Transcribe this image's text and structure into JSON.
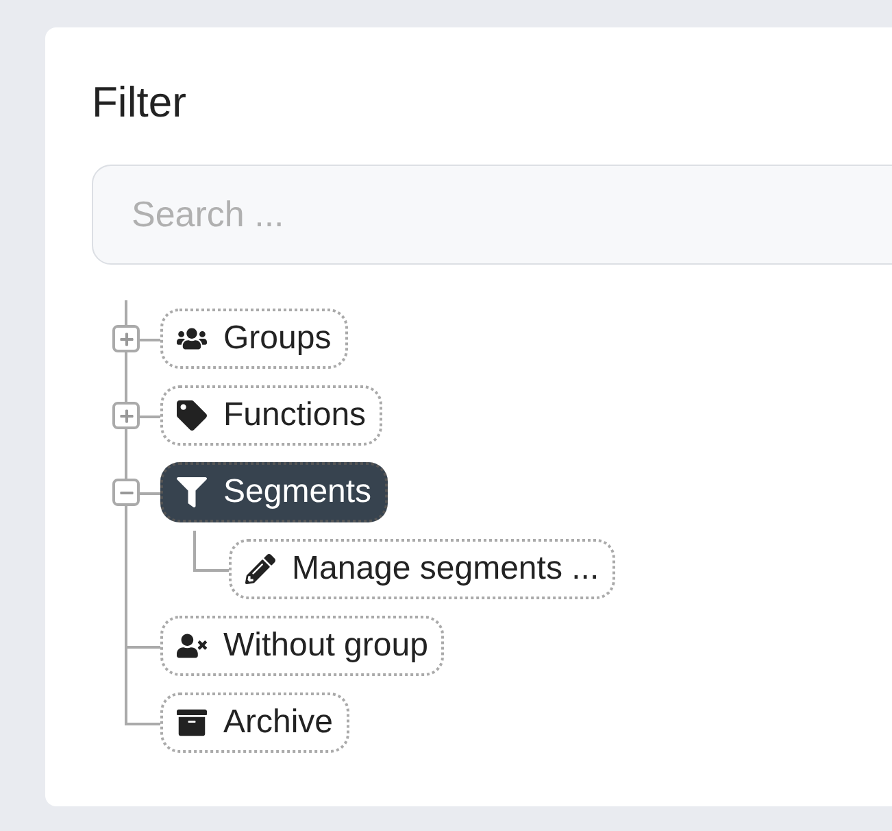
{
  "title": "Filter",
  "search": {
    "placeholder": "Search ..."
  },
  "tree": [
    {
      "label": "Groups",
      "expanded": false,
      "selected": false
    },
    {
      "label": "Functions",
      "expanded": false,
      "selected": false
    },
    {
      "label": "Segments",
      "expanded": true,
      "selected": true,
      "children": [
        {
          "label": "Manage segments ...",
          "selected": false
        }
      ]
    },
    {
      "label": "Without group",
      "selected": false
    },
    {
      "label": "Archive",
      "selected": false
    }
  ]
}
